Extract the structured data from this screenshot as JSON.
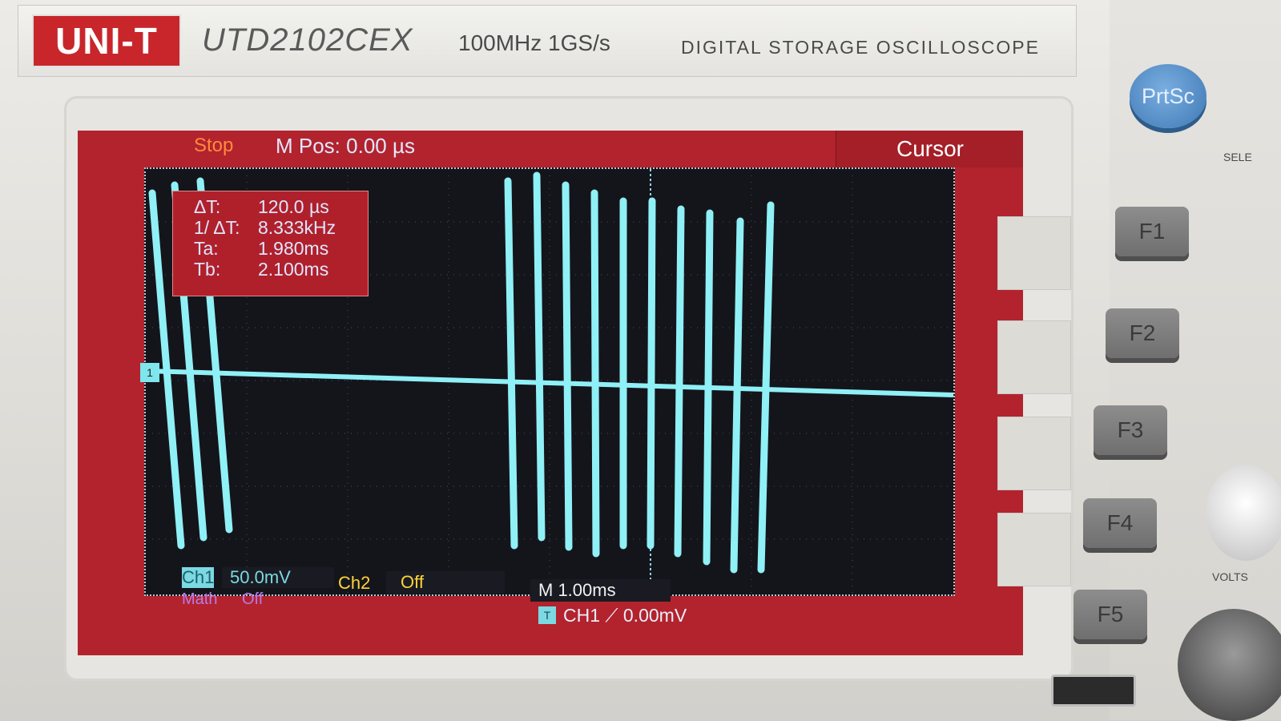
{
  "brand": {
    "logo": "UNI-T",
    "model": "UTD2102CEX",
    "spec": "100MHz  1GS/s",
    "description": "DIGITAL STORAGE OSCILLOSCOPE"
  },
  "screen": {
    "run_state": "Stop",
    "m_pos": "M Pos: 0.00 µs",
    "menu_title": "Cursor",
    "measurements": [
      {
        "label": "ΔT:",
        "value": "120.0 µs"
      },
      {
        "label": "1/ ΔT:",
        "value": "8.333kHz"
      },
      {
        "label": "Ta:",
        "value": "1.980ms"
      },
      {
        "label": "Tb:",
        "value": "2.100ms"
      }
    ],
    "channel_marker": "1",
    "ch1": {
      "label": "Ch1",
      "scale": "50.0mV"
    },
    "ch2": {
      "label": "Ch2",
      "state": "Off"
    },
    "math": {
      "label": "Math",
      "state": "Off"
    },
    "timebase": "M 1.00ms",
    "trigger_box": "T",
    "trigger": "CH1 ⟋  0.00mV",
    "colors": {
      "trace": "#7fe6ee",
      "background": "#b2232e",
      "grid": "#14151b"
    }
  },
  "buttons": {
    "prtsc": "PrtSc",
    "f1": "F1",
    "f2": "F2",
    "f3": "F3",
    "f4": "F4",
    "f5": "F5"
  },
  "side_labels": {
    "select": "SELE",
    "volts": "VOLTS"
  }
}
